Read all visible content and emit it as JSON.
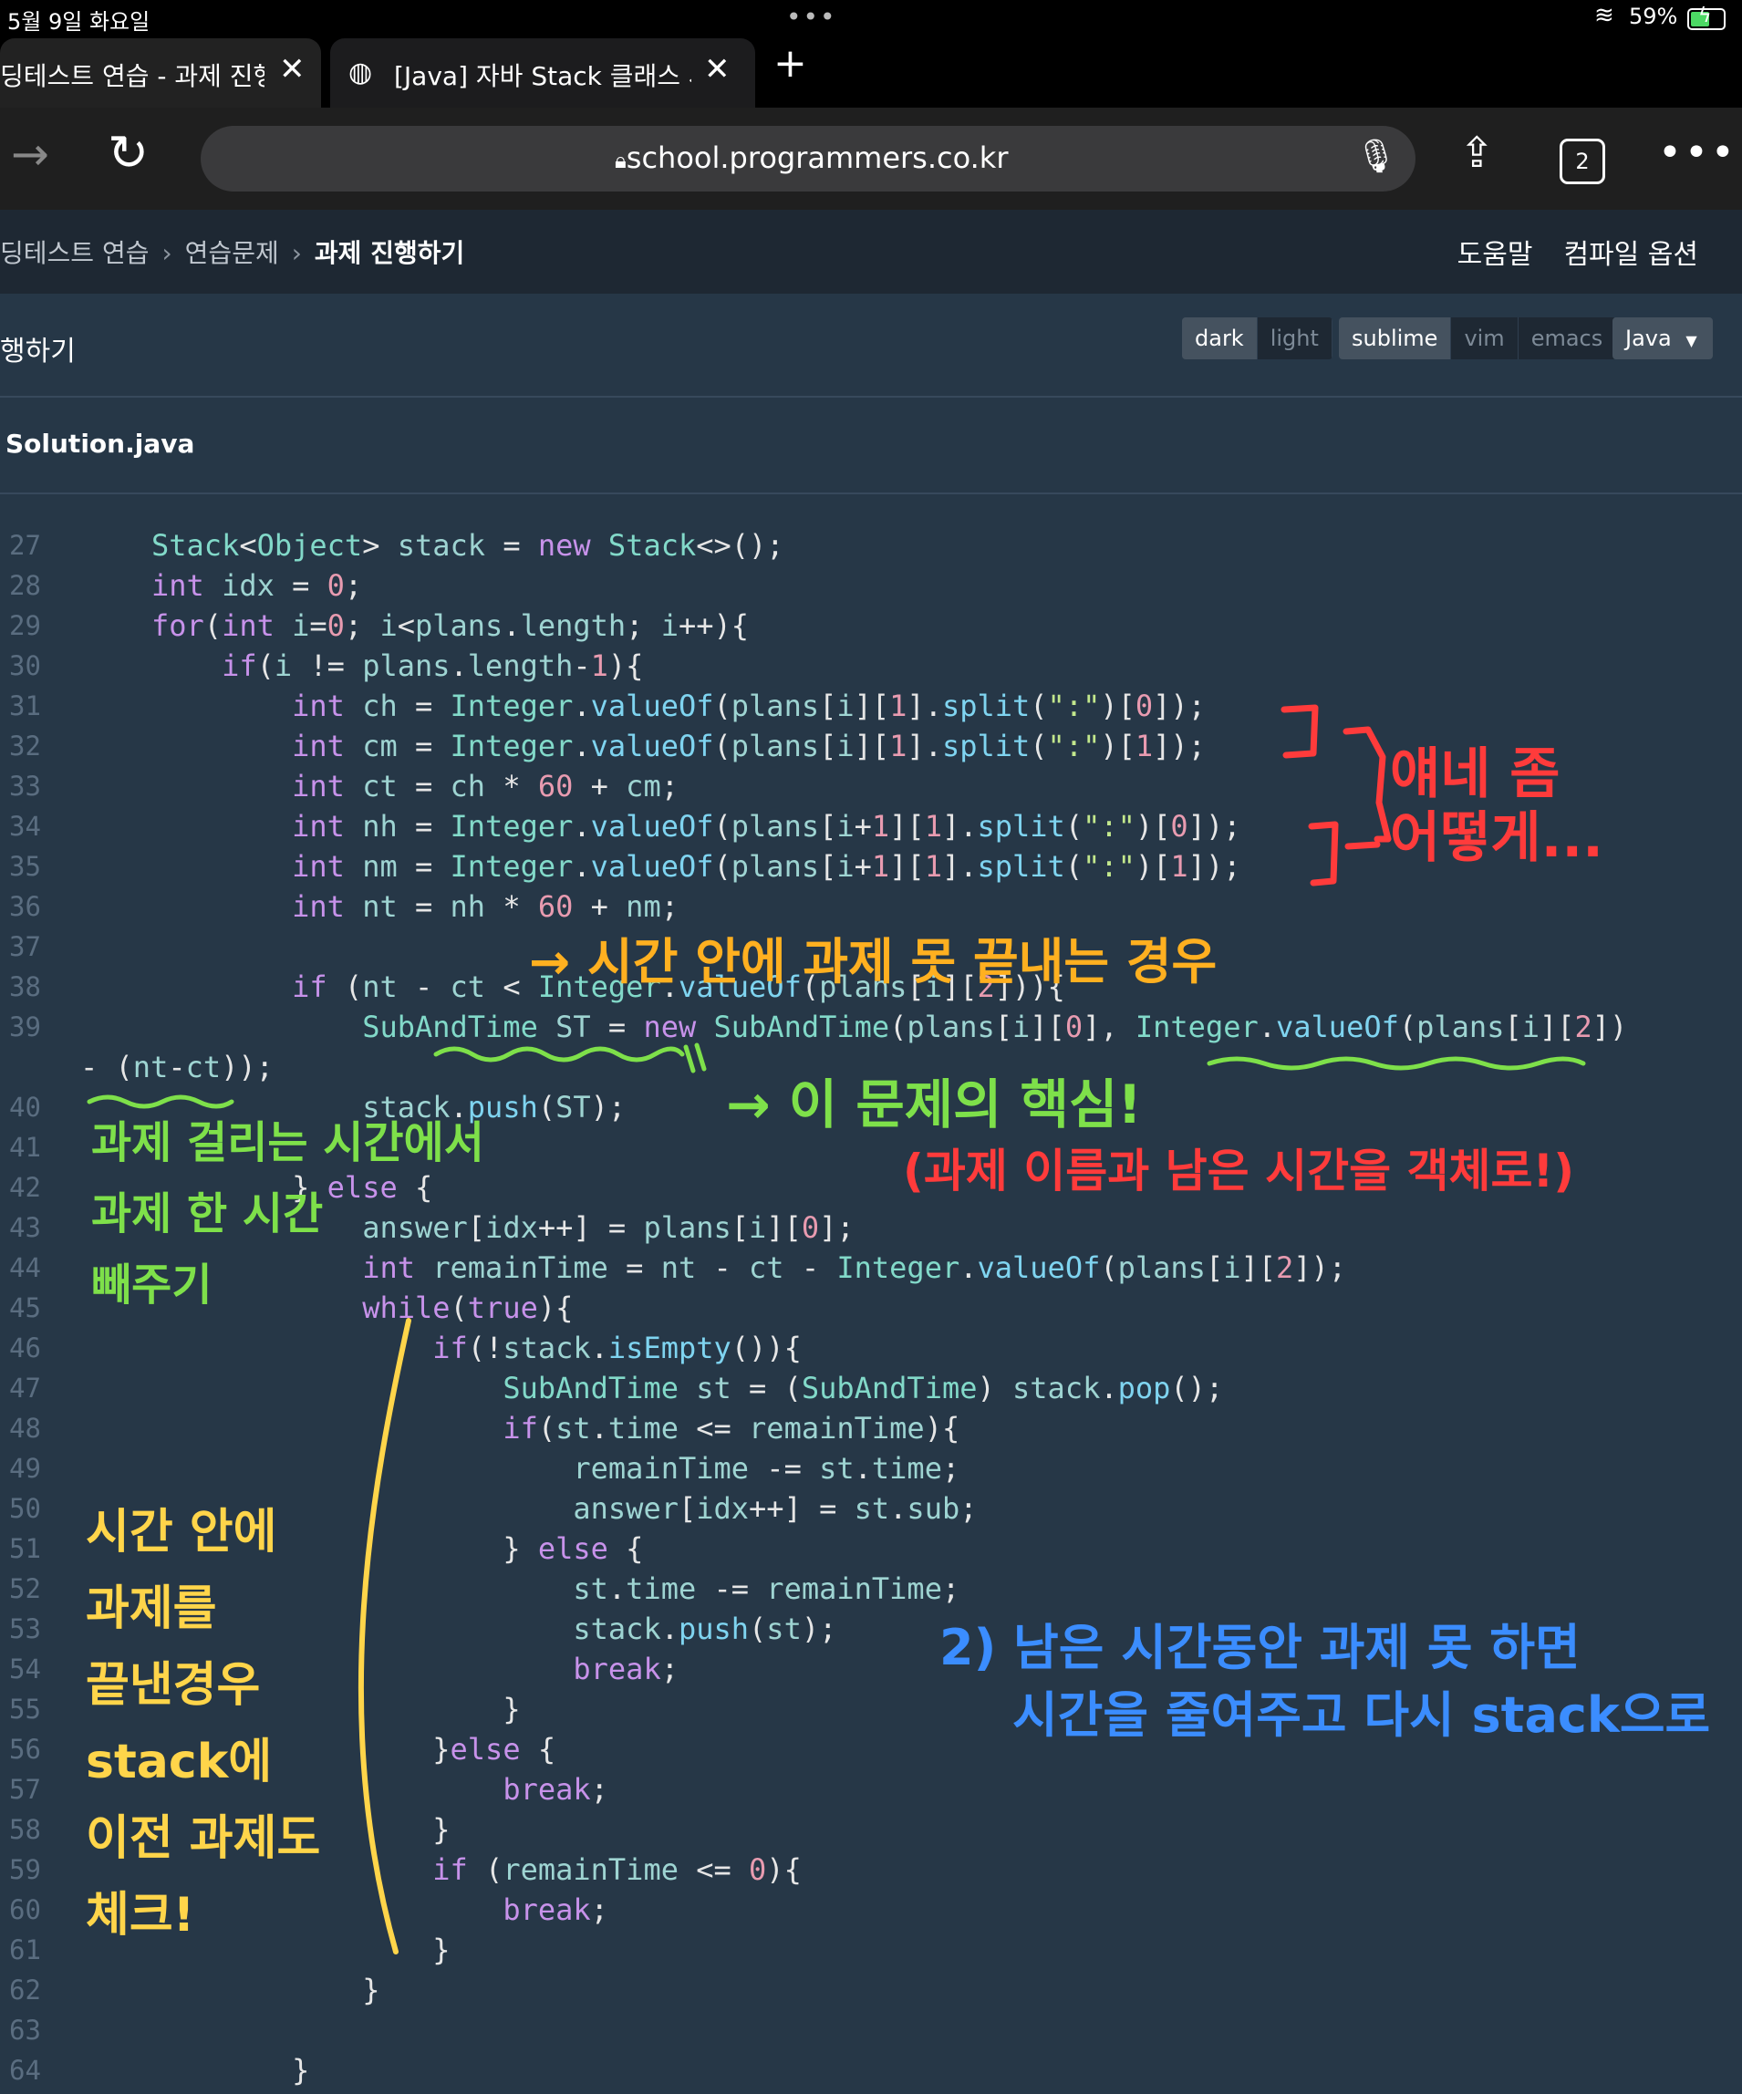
{
  "status": {
    "date": "5월 9일 화요일",
    "battery": "59%"
  },
  "tabs": [
    {
      "label": "딩테스트 연습 - 과제 진행하"
    },
    {
      "label": "[Java] 자바 Stack 클래스 사"
    }
  ],
  "toolbar": {
    "url": "school.programmers.co.kr",
    "tab_count": "2"
  },
  "breadcrumb": {
    "items": [
      "딩테스트 연습",
      "연습문제",
      "과제 진행하기"
    ]
  },
  "nav": {
    "help": "도움말",
    "compile": "컴파일 옵션"
  },
  "header": {
    "title": "행하기",
    "theme": [
      "dark",
      "light"
    ],
    "keymap": [
      "sublime",
      "vim",
      "emacs"
    ],
    "language": "Java"
  },
  "file": {
    "name": "Solution.java"
  },
  "code": {
    "line_numbers": [
      "27",
      "28",
      "29",
      "30",
      "31",
      "32",
      "33",
      "34",
      "35",
      "36",
      "37",
      "38",
      "39",
      "40",
      "41",
      "42",
      "43",
      "44",
      "45",
      "46",
      "47",
      "48",
      "49",
      "50",
      "51",
      "52",
      "53",
      "54",
      "55",
      "56",
      "57",
      "58",
      "59",
      "60",
      "61",
      "62",
      "63",
      "64"
    ],
    "lines": [
      "Stack<Object> stack = new Stack<>();",
      "int idx = 0;",
      "for(int i=0; i<plans.length; i++){",
      "    if(i != plans.length-1){",
      "        int ch = Integer.valueOf(plans[i][1].split(\":\")[0]);",
      "        int cm = Integer.valueOf(plans[i][1].split(\":\")[1]);",
      "        int ct = ch * 60 + cm;",
      "        int nh = Integer.valueOf(plans[i+1][1].split(\":\")[0]);",
      "        int nm = Integer.valueOf(plans[i+1][1].split(\":\")[1]);",
      "        int nt = nh * 60 + nm;",
      "",
      "        if (nt - ct < Integer.valueOf(plans[i][2])){",
      "            SubAndTime ST = new SubAndTime(plans[i][0], Integer.valueOf(plans[i][2])",
      "            stack.push(ST);",
      "",
      "        } else {",
      "            answer[idx++] = plans[i][0];",
      "            int remainTime = nt - ct - Integer.valueOf(plans[i][2]);",
      "            while(true){",
      "                if(!stack.isEmpty()){",
      "                    SubAndTime st = (SubAndTime) stack.pop();",
      "                    if(st.time <= remainTime){",
      "                        remainTime -= st.time;",
      "                        answer[idx++] = st.sub;",
      "                    } else {",
      "                        st.time -= remainTime;",
      "                        stack.push(st);",
      "                        break;",
      "                    }",
      "                }else {",
      "                    break;",
      "                }",
      "                if (remainTime <= 0){",
      "                    break;",
      "                }",
      "            }",
      "",
      "        }"
    ],
    "wrap_39": "- (nt-ct));"
  },
  "annotations": {
    "red_side": [
      "얘네 좀",
      "어떻게..."
    ],
    "red_core": "(과제 이름과 남은 시간을 객체로!)",
    "orange_case": "→ 시간 안에 과제 못 끝내는 경우",
    "green_core": "→ 이 문제의 핵심!",
    "green_left": [
      "과제 걸리는 시간에서",
      "과제 한 시간",
      "빼주기"
    ],
    "yellow_left": [
      "시간 안에",
      "과제를",
      "끝낸경우",
      "stack에",
      "이전 과제도",
      "체크!"
    ],
    "blue": [
      "2) 남은 시간동안 과제 못 하면",
      "시간을 줄여주고 다시 stack으로"
    ]
  }
}
